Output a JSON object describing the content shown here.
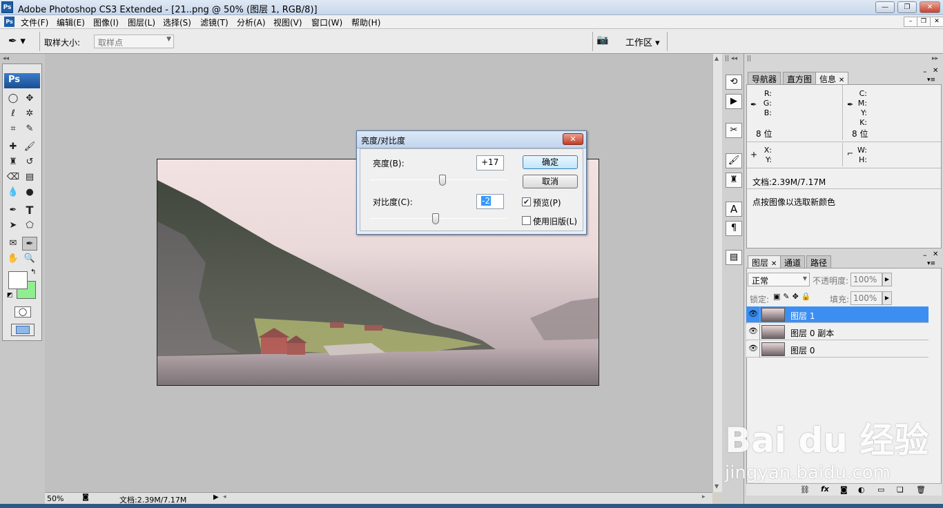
{
  "window": {
    "title": "Adobe Photoshop CS3 Extended - [21..png @ 50% (图层 1, RGB/8)]",
    "app_badge": "Ps"
  },
  "menu": [
    "文件(F)",
    "编辑(E)",
    "图像(I)",
    "图层(L)",
    "选择(S)",
    "滤镜(T)",
    "分析(A)",
    "视图(V)",
    "窗口(W)",
    "帮助(H)"
  ],
  "options": {
    "sample_size_label": "取样大小:",
    "sample_size_value": "取样点",
    "workspace": "工作区 ▾"
  },
  "toolbox": {
    "badge": "Ps"
  },
  "dialog": {
    "title": "亮度/对比度",
    "brightness_label": "亮度(B):",
    "brightness_value": "+17",
    "contrast_label": "对比度(C):",
    "contrast_value": "-2",
    "ok": "确定",
    "cancel": "取消",
    "preview_label": "预览(P)",
    "preview_checked": true,
    "legacy_label": "使用旧版(L)",
    "legacy_checked": false,
    "brightness_level": 0.06,
    "contrast_level": -0.04
  },
  "info_panel": {
    "tabs": [
      "导航器",
      "直方图",
      "信息"
    ],
    "active_tab": "信息",
    "rgb_labels": [
      "R:",
      "G:",
      "B:"
    ],
    "cmyk_labels": [
      "C:",
      "M:",
      "Y:",
      "K:"
    ],
    "bits_left": "8 位",
    "bits_right": "8 位",
    "xy_labels": [
      "X:",
      "Y:"
    ],
    "wh_labels": [
      "W:",
      "H:"
    ],
    "doc_size": "文档:2.39M/7.17M",
    "hint": "点按图像以选取新颜色"
  },
  "layers_panel": {
    "tabs": [
      "图层",
      "通道",
      "路径"
    ],
    "active_tab": "图层",
    "blend_mode": "正常",
    "opacity_label": "不透明度:",
    "opacity_value": "100%",
    "lock_label": "锁定:",
    "fill_label": "填充:",
    "fill_value": "100%",
    "layers": [
      {
        "name": "图层 1",
        "selected": true
      },
      {
        "name": "图层 0 副本",
        "selected": false
      },
      {
        "name": "图层 0",
        "selected": false
      }
    ]
  },
  "status": {
    "zoom": "50%",
    "doc": "文档:2.39M/7.17M"
  },
  "watermark": {
    "brand": "Bai du 经验",
    "url": "jingyan.baidu.com"
  },
  "colors": {
    "selection_blue": "#3c8ff0",
    "background_swatch": "#90ee90",
    "foreground_swatch": "#ffffff",
    "house_red": "#a63a33"
  }
}
